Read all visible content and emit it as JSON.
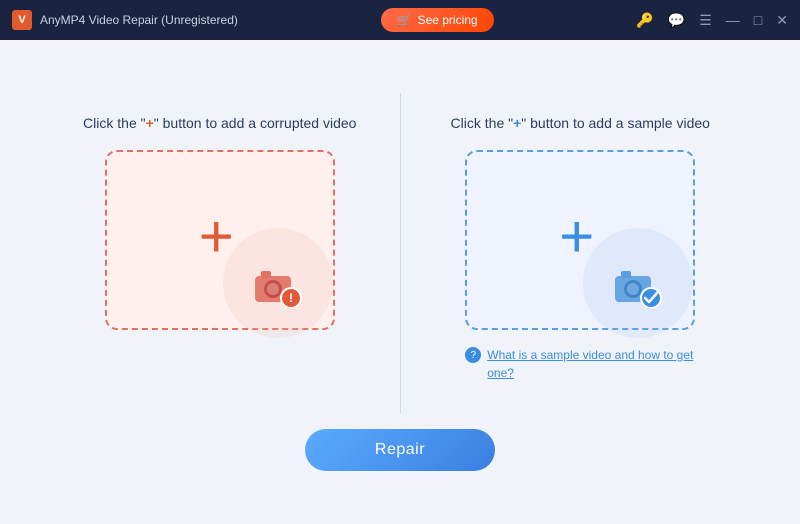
{
  "titleBar": {
    "appIcon": "V",
    "title": "AnyMP4 Video Repair (Unregistered)",
    "seePricingLabel": "See pricing",
    "icons": {
      "key": "🔑",
      "chat": "💬",
      "menu": "☰",
      "minimize": "—",
      "maximize": "□",
      "close": "✕"
    }
  },
  "leftPanel": {
    "instruction": "Click the \"+\" button to add a corrupted video",
    "plusSymbol": "+",
    "dropzoneType": "red"
  },
  "rightPanel": {
    "instruction": "Click the \"+\" button to add a sample video",
    "plusSymbol": "+",
    "dropzoneType": "blue",
    "sampleLink": "What is a sample video and how to get one?"
  },
  "repairButton": {
    "label": "Repair"
  }
}
